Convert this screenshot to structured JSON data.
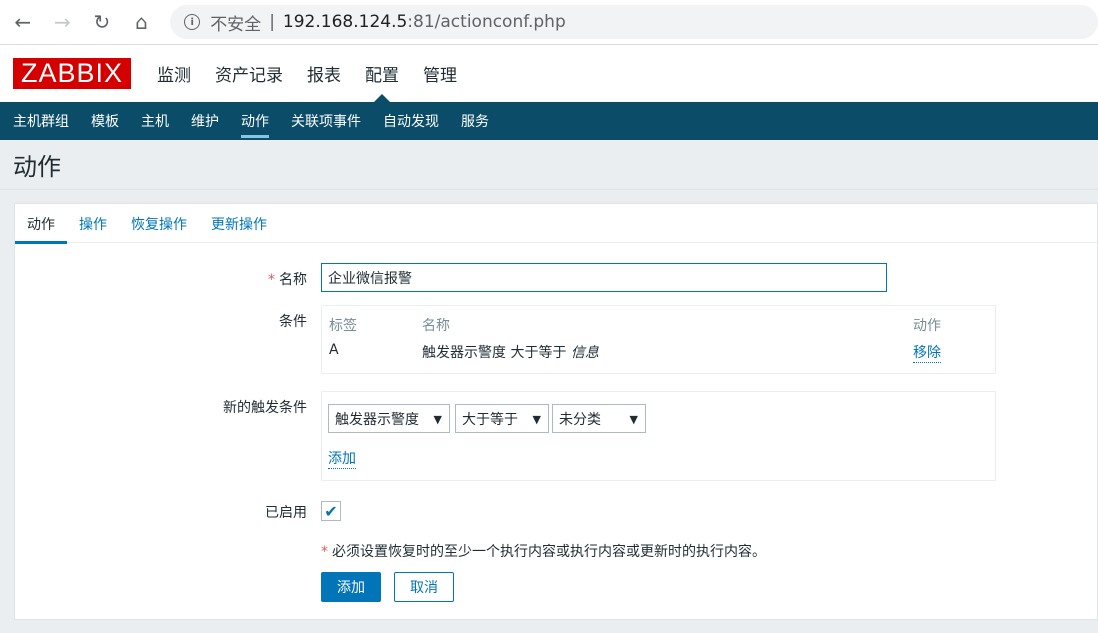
{
  "browser": {
    "back_icon": "←",
    "forward_icon": "→",
    "reload_icon": "↻",
    "home_icon": "⌂",
    "info_icon": "i",
    "insecure_label": "不安全",
    "separator": "|",
    "host": "192.168.124.5",
    "path": ":81/actionconf.php"
  },
  "header": {
    "logo": "ZABBIX",
    "menu": [
      "监测",
      "资产记录",
      "报表",
      "配置",
      "管理"
    ],
    "selected_menu": "配置"
  },
  "submenu": {
    "items": [
      "主机群组",
      "模板",
      "主机",
      "维护",
      "动作",
      "关联项事件",
      "自动发现",
      "服务"
    ],
    "selected": "动作"
  },
  "page": {
    "title": "动作"
  },
  "tabs": [
    "动作",
    "操作",
    "恢复操作",
    "更新操作"
  ],
  "form": {
    "name_label": "名称",
    "name_value": "企业微信报警",
    "required_mark": "*",
    "conditions_label": "条件",
    "conditions_table": {
      "headers": {
        "label": "标签",
        "name": "名称",
        "action": "动作"
      },
      "rows": [
        {
          "label": "A",
          "name_prefix": "触发器示警度 大于等于",
          "name_value": "信息",
          "action": "移除"
        }
      ]
    },
    "new_condition_label": "新的触发条件",
    "new_condition": {
      "type": "触发器示警度",
      "operator": "大于等于",
      "value": "未分类",
      "add_link": "添加"
    },
    "enabled_label": "已启用",
    "enabled": true,
    "check_icon": "✔",
    "note": "必须设置恢复时的至少一个执行内容或执行内容或更新时的执行内容。",
    "add_button": "添加",
    "cancel_button": "取消"
  },
  "colors": {
    "brand_red": "#d40000",
    "nav_dark": "#0b4d68",
    "link_blue": "#0275b8"
  }
}
